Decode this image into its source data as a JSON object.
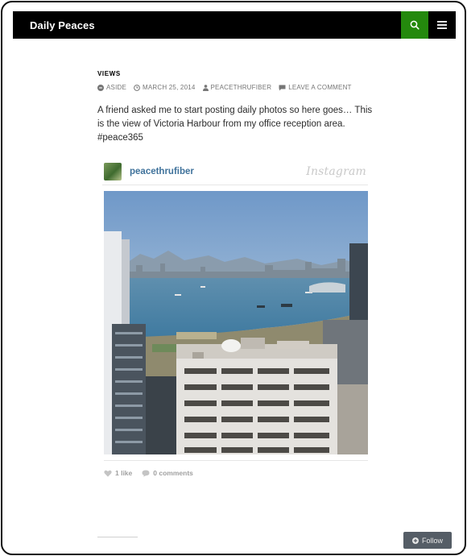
{
  "header": {
    "site_title": "Daily Peaces",
    "accent_color": "#24890d"
  },
  "post": {
    "category": "VIEWS",
    "meta": {
      "format": "ASIDE",
      "date": "MARCH 25, 2014",
      "author": "PEACETHRUFIBER",
      "comments_link": "LEAVE A COMMENT"
    },
    "body": "A friend asked me to start posting daily photos so here goes… This is the view of Victoria Harbour from my office reception area. #peace365"
  },
  "instagram": {
    "username": "peacethrufiber",
    "logo_text": "Instagram",
    "likes": "1 like",
    "comments": "0 comments"
  },
  "follow": {
    "label": "Follow"
  }
}
